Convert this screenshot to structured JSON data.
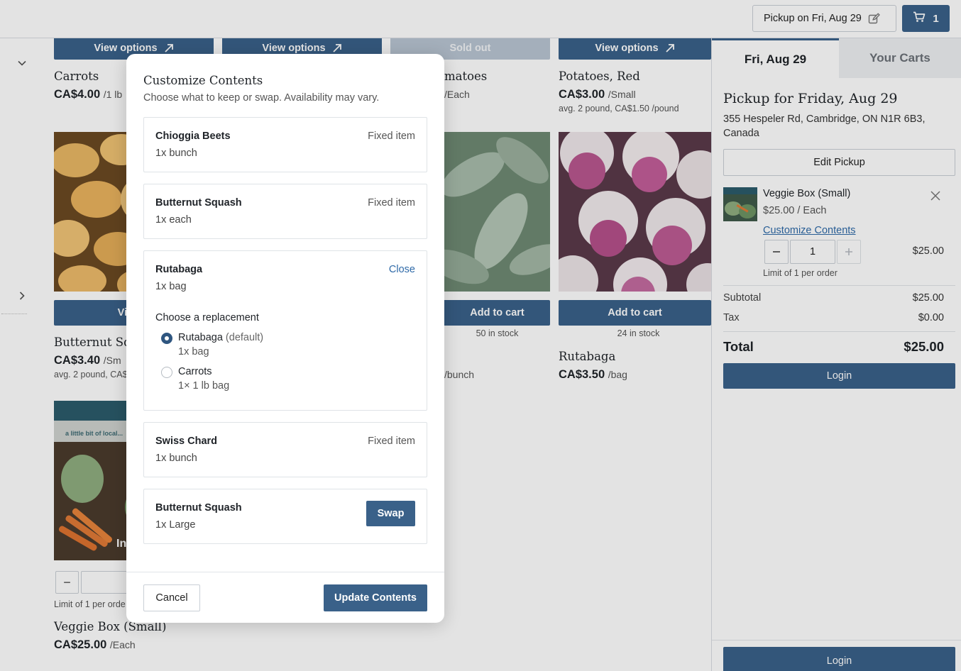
{
  "header": {
    "pickup_label": "Pickup on Fri, Aug 29",
    "cart_count": "1"
  },
  "products": {
    "row1": [
      {
        "button": "View options",
        "name": "Carrots",
        "price": "CA$4.00",
        "unit": "/1 lb"
      },
      {
        "button": "View options"
      },
      {
        "button": "Sold out",
        "name": "matoes",
        "unit": "/Each"
      },
      {
        "button": "View options",
        "name": "Potatoes, Red",
        "price": "CA$3.00",
        "unit": "/Small",
        "note": "avg. 2 pound, CA$1.50 /pound"
      }
    ],
    "row2": [
      {
        "button": "View o",
        "name": "Butternut Sq",
        "price": "CA$3.40",
        "unit": "/Sm",
        "note": "avg. 2 pound, CA$"
      },
      {
        "button": "Add to cart",
        "stock": "50 in stock",
        "unit": "/bunch"
      },
      {
        "button": "Add to cart",
        "stock": "24 in stock",
        "name": "Rutabaga",
        "price": "CA$3.50",
        "unit": "/bag"
      }
    ],
    "row3": [
      {
        "image_text": "a little bit of local...",
        "overlay_text": "In",
        "qty_minus": "−",
        "limit": "Limit of 1 per orde",
        "name": "Veggie Box (Small)",
        "price": "CA$25.00",
        "unit": "/Each"
      }
    ]
  },
  "modal": {
    "title": "Customize Contents",
    "subtitle": "Choose what to keep or swap. Availability may vary.",
    "items": [
      {
        "name": "Chioggia Beets",
        "qty": "1x bunch",
        "status": "Fixed item"
      },
      {
        "name": "Butternut Squash",
        "qty": "1x each",
        "status": "Fixed item"
      },
      {
        "name": "Rutabaga",
        "qty": "1x bag",
        "action": "Close"
      },
      {
        "name": "Swiss Chard",
        "qty": "1x bunch",
        "status": "Fixed item"
      },
      {
        "name": "Butternut Squash",
        "qty": "1x Large",
        "action": "Swap"
      }
    ],
    "replacement": {
      "heading": "Choose a replacement",
      "options": [
        {
          "name": "Rutabaga",
          "suffix": "(default)",
          "qty": "1x bag",
          "selected": true
        },
        {
          "name": "Carrots",
          "qty": "1× 1 lb bag",
          "selected": false
        }
      ]
    },
    "cancel_label": "Cancel",
    "update_label": "Update Contents"
  },
  "panel": {
    "tabs": [
      "Fri, Aug 29",
      "Your Carts"
    ],
    "pickup_title": "Pickup for Friday, Aug 29",
    "address": "355 Hespeler Rd, Cambridge, ON N1R 6B3, Canada",
    "edit_pickup": "Edit Pickup",
    "cart_item": {
      "name": "Veggie Box (Small)",
      "price": "$25.00 / Each",
      "customize": "Customize Contents",
      "qty": "1",
      "line_total": "$25.00",
      "limit": "Limit of 1 per order"
    },
    "subtotal_label": "Subtotal",
    "subtotal": "$25.00",
    "tax_label": "Tax",
    "tax": "$0.00",
    "total_label": "Total",
    "total": "$25.00",
    "login_label": "Login"
  },
  "colors": {
    "primary": "#3a6189",
    "sold_out": "#b9c5d2",
    "link": "#2f6aa8"
  }
}
